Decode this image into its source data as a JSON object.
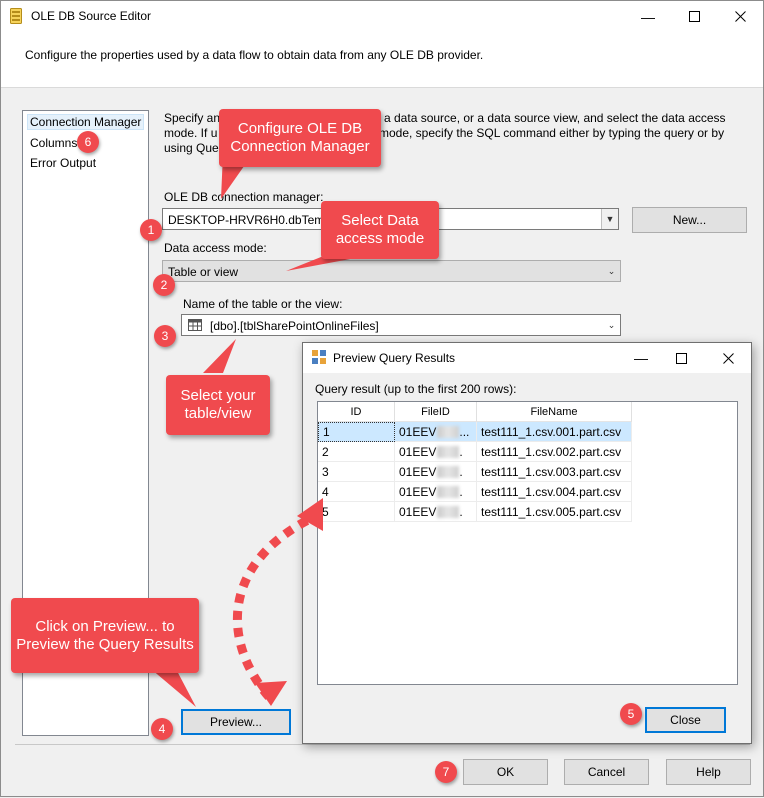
{
  "window": {
    "title": "OLE DB Source Editor",
    "description": "Configure the properties used by a data flow to obtain data from any OLE DB provider."
  },
  "nav": {
    "items": [
      {
        "label": "Connection Manager"
      },
      {
        "label": "Columns"
      },
      {
        "label": "Error Output"
      }
    ]
  },
  "content": {
    "specify_line1": "Specify an",
    "specify_line1b": "a data source, or a data source view, and select the data access",
    "specify_line2": "mode. If u",
    "specify_line2b": "mode, specify the SQL command either by typing the query or by",
    "specify_line3": "using Que",
    "conn_label": "OLE DB connection manager:",
    "conn_value": "DESKTOP-HRVR6H0.dbTemp",
    "new_button": "New...",
    "access_label": "Data access mode:",
    "access_value": "Table or view",
    "table_label": "Name of the table or the view:",
    "table_value": "[dbo].[tblSharePointOnlineFiles]",
    "preview_button": "Preview..."
  },
  "footer": {
    "ok": "OK",
    "cancel": "Cancel",
    "help": "Help"
  },
  "preview_dialog": {
    "title": "Preview Query Results",
    "label": "Query result (up to the first 200 rows):",
    "columns": [
      "ID",
      "FileID",
      "FileName"
    ],
    "rows": [
      {
        "id": "1",
        "fileid": "01EEV",
        "fileid_suffix": "...",
        "filename": "test111_1.csv.001.part.csv"
      },
      {
        "id": "2",
        "fileid": "01EEV",
        "fileid_suffix": ".",
        "filename": "test111_1.csv.002.part.csv"
      },
      {
        "id": "3",
        "fileid": "01EEV",
        "fileid_suffix": ".",
        "filename": "test111_1.csv.003.part.csv"
      },
      {
        "id": "4",
        "fileid": "01EEV",
        "fileid_suffix": ".",
        "filename": "test111_1.csv.004.part.csv"
      },
      {
        "id": "5",
        "fileid": "01EEV",
        "fileid_suffix": ".",
        "filename": "test111_1.csv.005.part.csv"
      }
    ],
    "close_button": "Close"
  },
  "callouts": {
    "configure": "Configure OLE DB Connection Manager",
    "select_mode": "Select Data access mode",
    "select_table": "Select your table/view",
    "click_preview": "Click on Preview... to Preview the Query Results"
  },
  "badges": [
    "1",
    "2",
    "3",
    "4",
    "5",
    "6",
    "7"
  ],
  "colors": {
    "callout": "#f04a4e",
    "selection": "#cce8ff",
    "focus_border": "#0078d7"
  }
}
